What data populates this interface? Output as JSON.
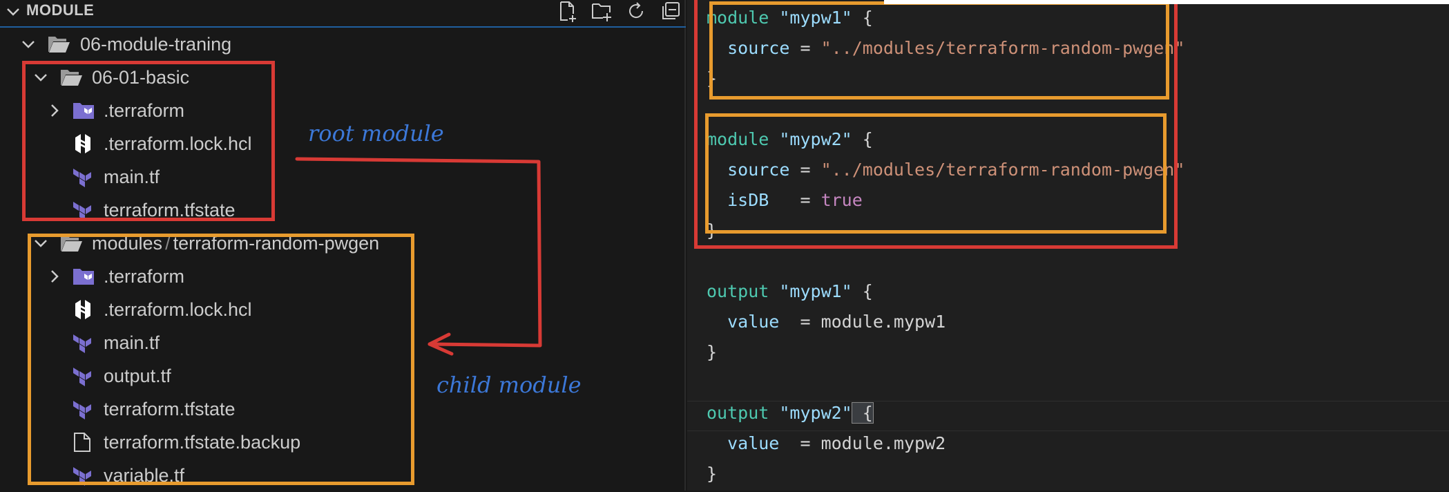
{
  "explorer": {
    "section_title": "MODULE",
    "actions": [
      "new-file-icon",
      "new-folder-icon",
      "refresh-icon",
      "collapse-all-icon"
    ],
    "tree": [
      {
        "label": "06-module-traning",
        "type": "folder-open",
        "depth": 0
      },
      {
        "label": "06-01-basic",
        "type": "folder-open",
        "depth": 1
      },
      {
        "label": ".terraform",
        "type": "folder-terraform",
        "depth": 2
      },
      {
        "label": ".terraform.lock.hcl",
        "type": "hcl-file",
        "depth": 2
      },
      {
        "label": "main.tf",
        "type": "terraform-file",
        "depth": 2
      },
      {
        "label": "terraform.tfstate",
        "type": "terraform-file",
        "depth": 2
      },
      {
        "label_a": "modules",
        "label_sep": "/",
        "label_b": "terraform-random-pwgen",
        "type": "folder-open",
        "depth": 1
      },
      {
        "label": ".terraform",
        "type": "folder-terraform",
        "depth": 2
      },
      {
        "label": ".terraform.lock.hcl",
        "type": "hcl-file",
        "depth": 2
      },
      {
        "label": "main.tf",
        "type": "terraform-file",
        "depth": 2
      },
      {
        "label": "output.tf",
        "type": "terraform-file",
        "depth": 2
      },
      {
        "label": "terraform.tfstate",
        "type": "terraform-file",
        "depth": 2
      },
      {
        "label": "terraform.tfstate.backup",
        "type": "generic-file",
        "depth": 2
      },
      {
        "label": "variable.tf",
        "type": "terraform-file",
        "depth": 2
      }
    ]
  },
  "annotations": {
    "root_label": "root module",
    "child_label": "child module",
    "colors": {
      "red": "#d83a35",
      "orange": "#e89b2e",
      "blue": "#3c78d8"
    }
  },
  "editor": {
    "lines": [
      {
        "kw": "module",
        "name": "\"mypw1\"",
        "rest": " {"
      },
      {
        "prop": "  source",
        "op": " = ",
        "str": "\"../modules/terraform-random-pwgen\""
      },
      {
        "rest": "}"
      },
      {
        "rest": ""
      },
      {
        "kw": "module",
        "name": "\"mypw2\"",
        "rest": " {"
      },
      {
        "prop": "  source",
        "op": " = ",
        "str": "\"../modules/terraform-random-pwgen\""
      },
      {
        "prop": "  isDB",
        "op": "   = ",
        "bool": "true"
      },
      {
        "rest": "}"
      },
      {
        "rest": ""
      },
      {
        "kw": "output",
        "name": "\"mypw1\"",
        "rest": " {"
      },
      {
        "prop": "  value",
        "op": "  = ",
        "plain": "module.mypw1"
      },
      {
        "rest": "}"
      },
      {
        "rest": ""
      },
      {
        "kw": "output",
        "name": "\"mypw2\"",
        "rest": " {"
      },
      {
        "prop": "  value",
        "op": "  = ",
        "plain": "module.mypw2"
      },
      {
        "rest": "}"
      }
    ]
  }
}
